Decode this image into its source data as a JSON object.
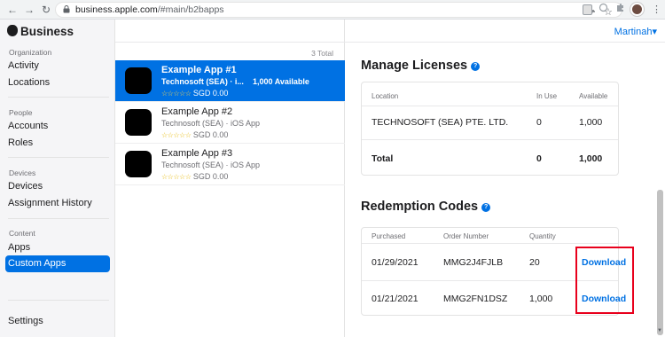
{
  "browser": {
    "back_glyph": "←",
    "forward_glyph": "→",
    "reload_glyph": "↻",
    "url_host": "business.apple.com",
    "url_path": "/#main/b2bapps"
  },
  "sidebar": {
    "brand": "Business",
    "sections": [
      {
        "heading": "Organization",
        "items": [
          "Activity",
          "Locations"
        ]
      },
      {
        "heading": "People",
        "items": [
          "Accounts",
          "Roles"
        ]
      },
      {
        "heading": "Devices",
        "items": [
          "Devices",
          "Assignment History"
        ]
      },
      {
        "heading": "Content",
        "items": [
          "Apps",
          "Custom Apps"
        ]
      }
    ],
    "active_item": "Custom Apps",
    "settings": "Settings"
  },
  "applist": {
    "total": "3 Total",
    "apps": [
      {
        "name": "Example App #1",
        "developer": "Technosoft (SEA) · i...",
        "price": "SGD 0.00",
        "stars": "☆☆☆☆☆",
        "available": "1,000 Available"
      },
      {
        "name": "Example App #2",
        "developer": "Technosoft (SEA) · iOS App",
        "price": "SGD 0.00",
        "stars": "☆☆☆☆☆"
      },
      {
        "name": "Example App #3",
        "developer": "Technosoft (SEA) · iOS App",
        "price": "SGD 0.00",
        "stars": "☆☆☆☆☆"
      }
    ]
  },
  "header": {
    "user": "Martinah",
    "user_chevron": "▾"
  },
  "licenses": {
    "title": "Manage Licenses",
    "columns": [
      "Location",
      "In Use",
      "Available"
    ],
    "rows": [
      {
        "location": "TECHNOSOFT (SEA) PTE. LTD.",
        "in_use": "0",
        "available": "1,000"
      }
    ],
    "total": {
      "label": "Total",
      "in_use": "0",
      "available": "1,000"
    }
  },
  "redemption": {
    "title": "Redemption Codes",
    "columns": [
      "Purchased",
      "Order Number",
      "Quantity"
    ],
    "rows": [
      {
        "purchased": "01/29/2021",
        "order": "MMG2J4FJLB",
        "quantity": "20",
        "action": "Download"
      },
      {
        "purchased": "01/21/2021",
        "order": "MMG2FN1DSZ",
        "quantity": "1,000",
        "action": "Download"
      }
    ]
  },
  "colors": {
    "accent": "#0071e3",
    "highlight_box": "#e8001c"
  }
}
